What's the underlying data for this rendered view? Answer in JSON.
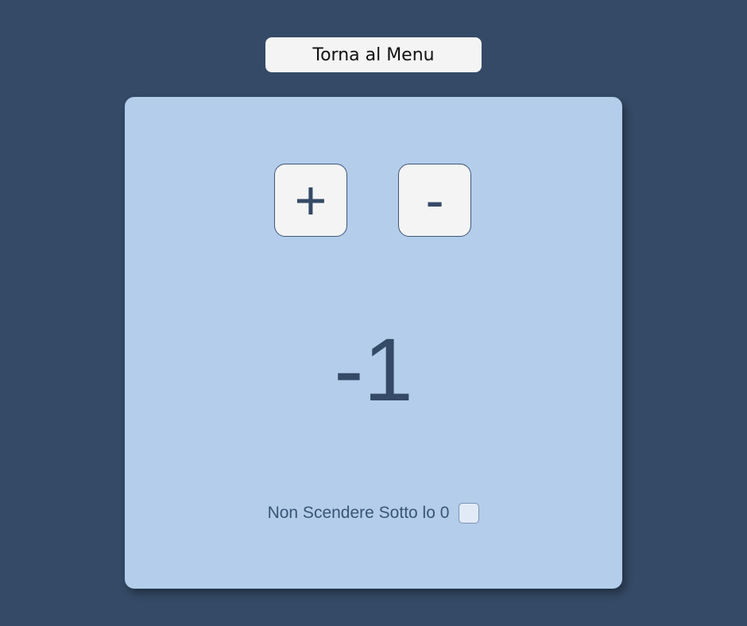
{
  "header": {
    "menu_button_label": "Torna al Menu"
  },
  "counter": {
    "increment_label": "+",
    "decrement_label": "-",
    "value": "-1",
    "option": {
      "label": "Non Scendere Sotto lo 0",
      "checked": false
    }
  },
  "colors": {
    "background": "#344a66",
    "card": "#b3cdeb",
    "button": "#f4f4f4",
    "text": "#344a66"
  }
}
